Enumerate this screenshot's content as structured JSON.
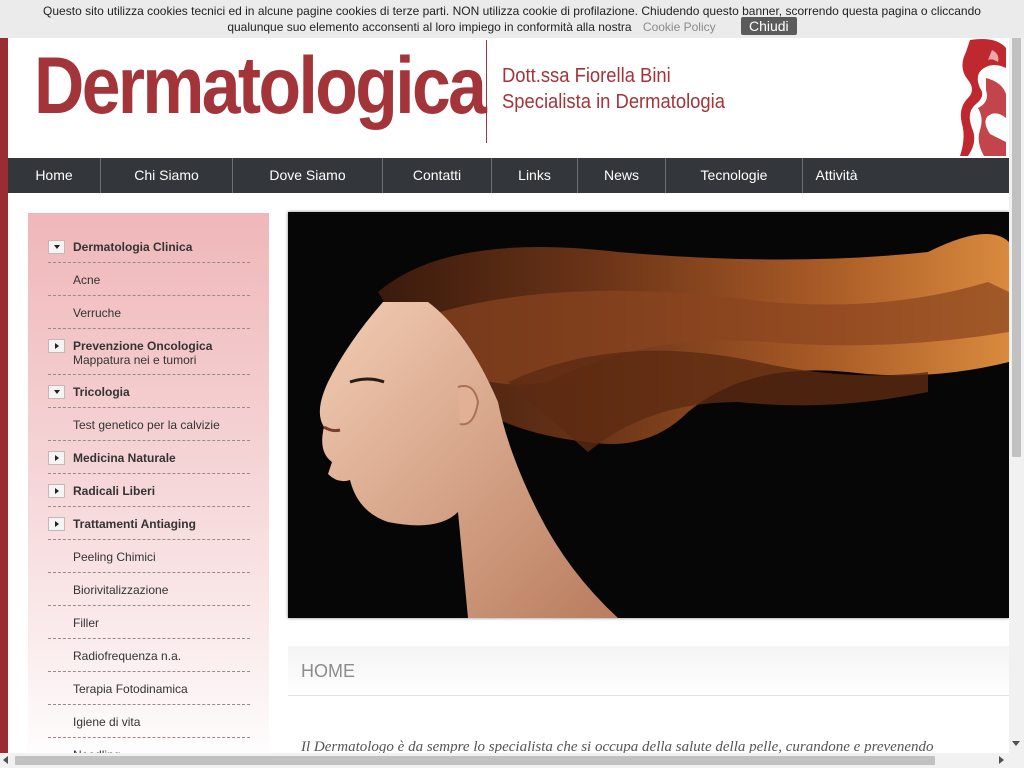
{
  "cookie": {
    "text_line1": "Questo sito utilizza cookies tecnici ed in alcune pagine cookies di terze parti. NON utilizza cookie di profilazione. Chiudendo questo banner, scorrendo questa pagina o cliccando",
    "text_line2": "qualunque suo elemento acconsenti al loro impiego in conformità alla nostra",
    "policy_link": "Cookie Policy",
    "close_label": "Chiudi"
  },
  "header": {
    "brand": "Dermatologica",
    "doctor_name": "Dott.ssa Fiorella Bini",
    "specialty": "Specialista in Dermatologia"
  },
  "nav": {
    "items": [
      {
        "label": "Home"
      },
      {
        "label": "Chi Siamo"
      },
      {
        "label": "Dove Siamo"
      },
      {
        "label": "Contatti"
      },
      {
        "label": "Links"
      },
      {
        "label": "News"
      },
      {
        "label": "Tecnologie"
      },
      {
        "label": "Attività"
      }
    ]
  },
  "sidebar": {
    "items": [
      {
        "label": "Dermatologia Clinica",
        "bold": true,
        "arrow": "down"
      },
      {
        "label": "Acne",
        "bold": false,
        "arrow": "none"
      },
      {
        "label": "Verruche",
        "bold": false,
        "arrow": "none"
      },
      {
        "label": "Prevenzione Oncologica",
        "sub": "Mappatura nei e tumori",
        "bold": true,
        "arrow": "right"
      },
      {
        "label": "Tricologia",
        "bold": true,
        "arrow": "down"
      },
      {
        "label": "Test genetico per la calvizie",
        "bold": false,
        "arrow": "none"
      },
      {
        "label": "Medicina Naturale",
        "bold": true,
        "arrow": "right"
      },
      {
        "label": "Radicali Liberi",
        "bold": true,
        "arrow": "right"
      },
      {
        "label": "Trattamenti Antiaging",
        "bold": true,
        "arrow": "right"
      },
      {
        "label": "Peeling Chimici",
        "bold": false,
        "arrow": "none"
      },
      {
        "label": "Biorivitalizzazione",
        "bold": false,
        "arrow": "none"
      },
      {
        "label": "Filler",
        "bold": false,
        "arrow": "none"
      },
      {
        "label": "Radiofrequenza n.a.",
        "bold": false,
        "arrow": "none"
      },
      {
        "label": "Terapia Fotodinamica",
        "bold": false,
        "arrow": "none"
      },
      {
        "label": "Igiene di vita",
        "bold": false,
        "arrow": "none"
      },
      {
        "label": "Needling",
        "bold": false,
        "arrow": "none"
      }
    ]
  },
  "main": {
    "section_title": "HOME",
    "intro": "Il Dermatologo è da sempre lo specialista che si occupa della salute della pelle, curandone e prevenendo"
  },
  "colors": {
    "brand": "#a3343a",
    "nav_bg": "#33363b",
    "cookie_bg": "#ebebeb"
  }
}
